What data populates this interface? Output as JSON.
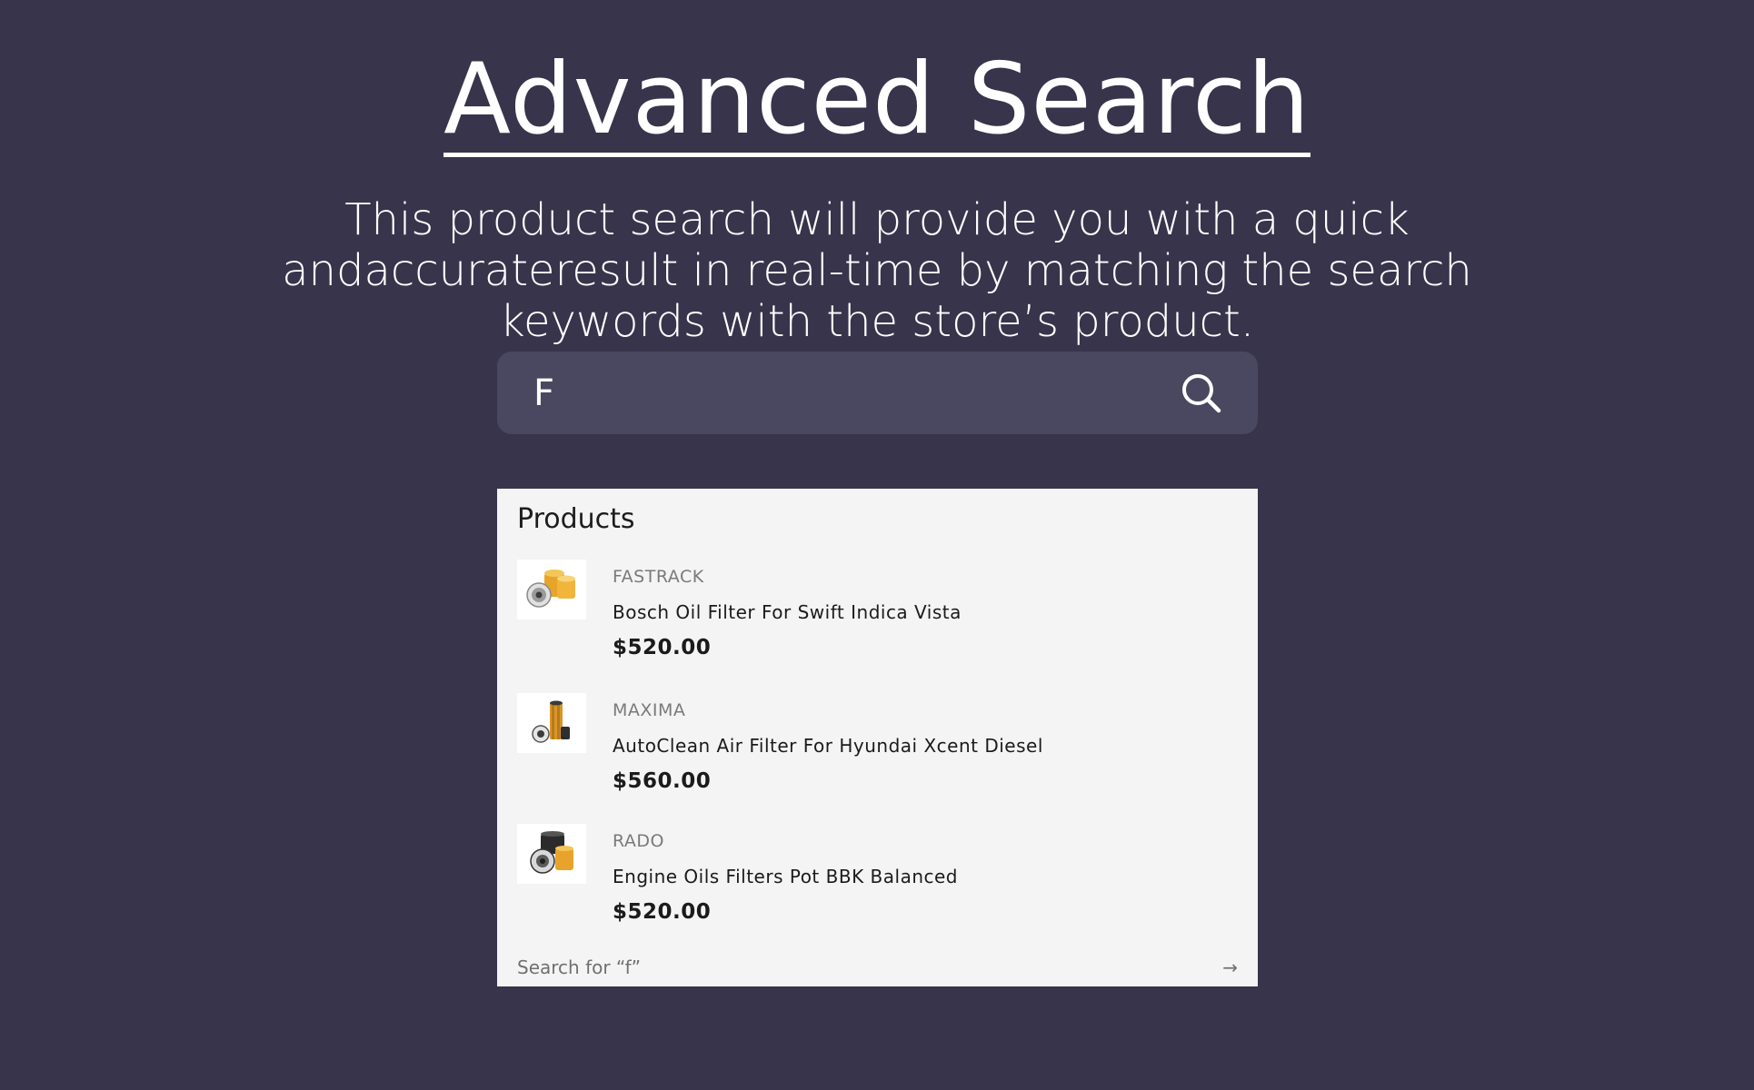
{
  "header": {
    "title": "Advanced Search",
    "description": "This product search will provide you with a quick andaccurateresult in real-time by matching the search keywords with the store’s product."
  },
  "search": {
    "value": "F",
    "icon": "search-icon"
  },
  "results": {
    "heading": "Products",
    "products": [
      {
        "brand": "FASTRACK",
        "name": "Bosch Oil Filter For Swift Indica Vista",
        "price": "$520.00",
        "thumbnail": "oil-filter-icon"
      },
      {
        "brand": "MAXIMA",
        "name": "AutoClean Air Filter For Hyundai Xcent Diesel",
        "price": "$560.00",
        "thumbnail": "air-filter-icon"
      },
      {
        "brand": "RADO",
        "name": "Engine Oils Filters Pot BBK Balanced",
        "price": "$520.00",
        "thumbnail": "oil-filters-icon"
      }
    ],
    "search_for_label": "Search for “f”",
    "arrow": "→"
  },
  "colors": {
    "background": "#37344b",
    "search_bar": "#4a4760",
    "dropdown": "#f4f4f4",
    "filter_orange": "#e8a42a"
  }
}
